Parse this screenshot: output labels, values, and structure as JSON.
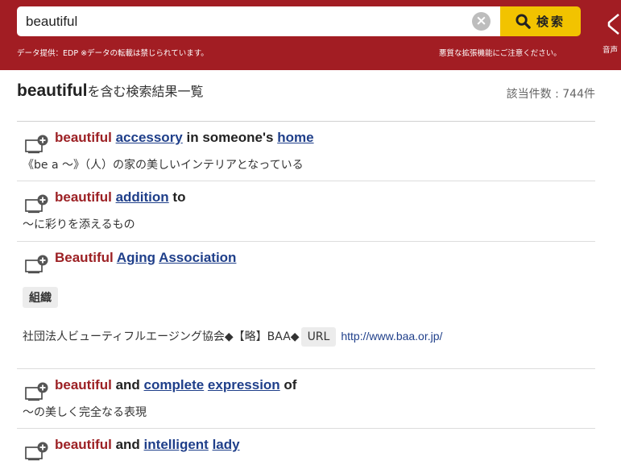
{
  "search": {
    "query": "beautiful",
    "clear_symbol": "×",
    "button_label": "検索",
    "source_note": "データ提供：EDP ※データの転載は禁じられています。",
    "warning_note": "悪質な拡張機能にご注意ください。",
    "audio_label": "音声"
  },
  "results": {
    "keyword": "beautiful",
    "suffix": "を含む検索結果一覧",
    "count_text": "該当件数 : 744件"
  },
  "entries": [
    {
      "title": [
        {
          "text": "beautiful",
          "kind": "kw"
        },
        {
          "text": "accessory",
          "kind": "link"
        },
        {
          "text": "in someone's",
          "kind": "plain"
        },
        {
          "text": "home",
          "kind": "link"
        }
      ],
      "desc": "《be a ～》（人）の家の美しいインテリアとなっている"
    },
    {
      "title": [
        {
          "text": "beautiful",
          "kind": "kw"
        },
        {
          "text": "addition",
          "kind": "link"
        },
        {
          "text": "to",
          "kind": "plain"
        }
      ],
      "desc": "～に彩りを添えるもの"
    },
    {
      "title": [
        {
          "text": "Beautiful",
          "kind": "kw"
        },
        {
          "text": "Aging",
          "kind": "link"
        },
        {
          "text": "Association",
          "kind": "link"
        }
      ],
      "tag": "組織",
      "desc_text": "社団法人ビューティフルエージング協会◆【略】BAA◆",
      "url_label": "URL",
      "url": "http://www.baa.or.jp/"
    },
    {
      "title": [
        {
          "text": "beautiful",
          "kind": "kw"
        },
        {
          "text": "and",
          "kind": "plain"
        },
        {
          "text": "complete",
          "kind": "link"
        },
        {
          "text": "expression",
          "kind": "link"
        },
        {
          "text": "of",
          "kind": "plain"
        }
      ],
      "desc": "～の美しく完全なる表現"
    },
    {
      "title": [
        {
          "text": "beautiful",
          "kind": "kw"
        },
        {
          "text": "and",
          "kind": "plain"
        },
        {
          "text": "intelligent",
          "kind": "link"
        },
        {
          "text": "lady",
          "kind": "link"
        }
      ]
    }
  ],
  "colors": {
    "header_bg": "#a21d23",
    "search_button": "#f2c300",
    "keyword": "#9c2024",
    "link": "#1f3f8a"
  },
  "icons": {
    "search": "magnifier-icon",
    "clear": "clear-circle-icon",
    "add": "add-to-wordbook-icon",
    "audio": "speaker-icon"
  }
}
